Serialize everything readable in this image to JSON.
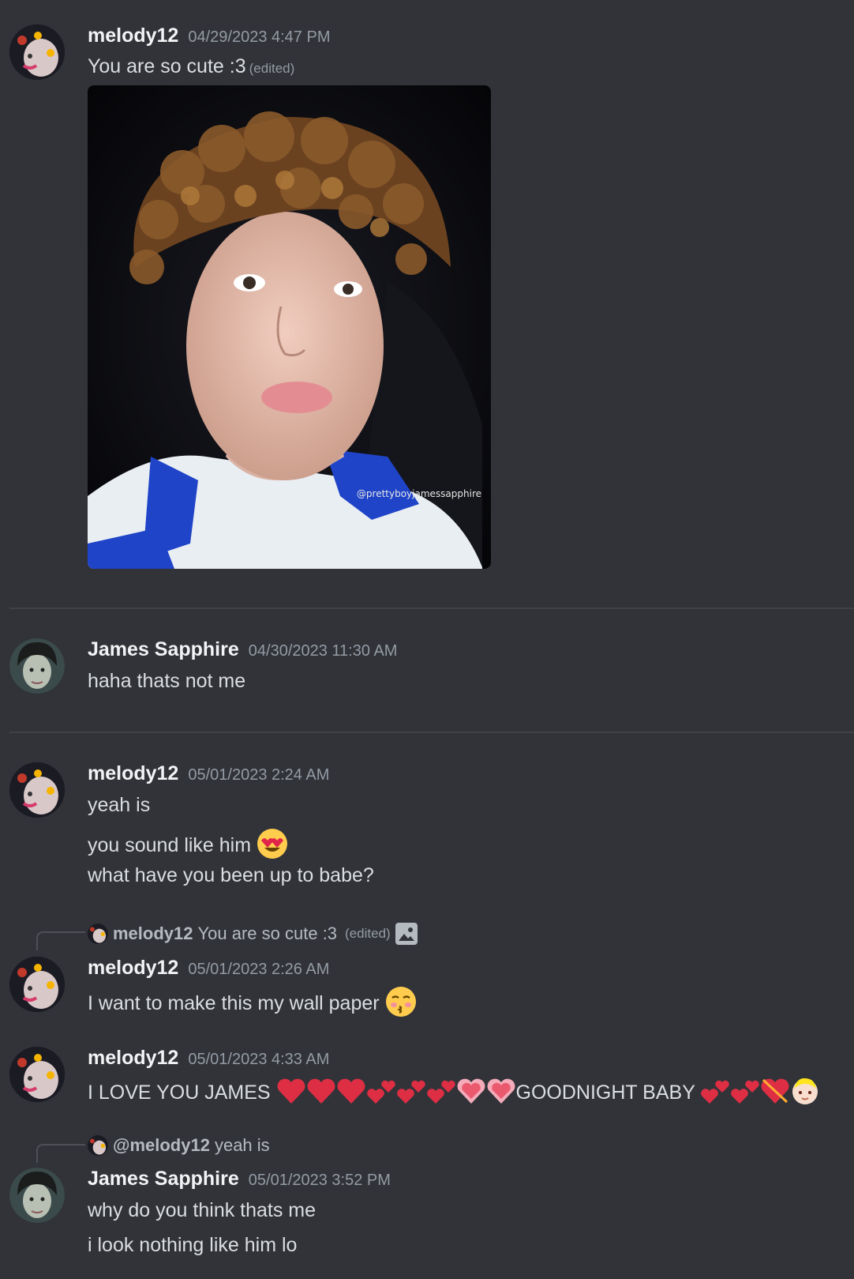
{
  "messages": [
    {
      "author": "melody12",
      "timestamp": "04/29/2023 4:47 PM",
      "lines": [
        "You are so cute :3"
      ],
      "edited_label": "(edited)",
      "attachment_watermark": "@prettyboyjamessapphire"
    },
    {
      "author": "James Sapphire",
      "timestamp": "04/30/2023 11:30 AM",
      "lines": [
        "haha thats not me"
      ]
    },
    {
      "author": "melody12",
      "timestamp": "05/01/2023 2:24 AM",
      "lines": [
        "yeah is",
        "you sound like him",
        "what have you been up to babe?"
      ]
    },
    {
      "reply": {
        "author": "melody12",
        "text": "You are so cute :3",
        "edited_label": "(edited)"
      },
      "author": "melody12",
      "timestamp": "05/01/2023 2:26 AM",
      "lines": [
        "I want to make this my wall paper"
      ]
    },
    {
      "author": "melody12",
      "timestamp": "05/01/2023 4:33 AM",
      "lines": [
        "I LOVE YOU JAMES",
        "GOODNIGHT BABY"
      ]
    },
    {
      "reply": {
        "author": "@melody12",
        "text": "yeah is"
      },
      "author": "James Sapphire",
      "timestamp": "05/01/2023 3:52 PM",
      "lines": [
        "why do you think thats me",
        "i look nothing like him lo"
      ]
    }
  ],
  "icons": {
    "heart_eyes": "smiling-face-with-heart-eyes",
    "kissing": "face-blowing-kiss",
    "hearts": "red-hearts",
    "image": "image-icon"
  },
  "colors": {
    "background": "#313338",
    "text": "#dbdee1",
    "muted": "#949ba4",
    "heart": "#dd2e44"
  }
}
